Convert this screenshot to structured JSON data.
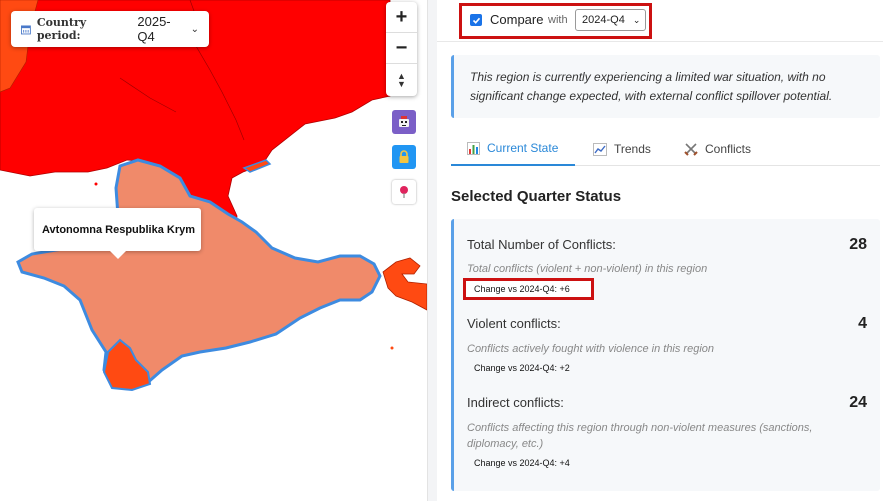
{
  "map": {
    "period_label": "Country period:",
    "period_value": "2025-Q4",
    "zoom_in": "+",
    "zoom_out": "−",
    "tooltip": "Avtonomna Respublika Krym"
  },
  "compare": {
    "label": "Compare",
    "checked": true,
    "with_label": "with",
    "value": "2024-Q4"
  },
  "callout_text": "This region is currently experiencing a limited war situation, with no significant change expected, with external conflict spillover potential.",
  "tabs": [
    {
      "label": "Current State",
      "icon": "bar-chart-icon",
      "active": true
    },
    {
      "label": "Trends",
      "icon": "line-chart-icon",
      "active": false
    },
    {
      "label": "Conflicts",
      "icon": "crossed-swords-icon",
      "active": false
    }
  ],
  "section_title": "Selected Quarter Status",
  "stats": [
    {
      "name": "Total Number of Conflicts:",
      "value": "28",
      "description": "Total conflicts (violent + non-violent) in this region",
      "change": "Change vs 2024-Q4: +6"
    },
    {
      "name": "Violent conflicts:",
      "value": "4",
      "description": "Conflicts actively fought with violence in this region",
      "change": "Change vs 2024-Q4: +2"
    },
    {
      "name": "Indirect conflicts:",
      "value": "24",
      "description": "Conflicts affecting this region through non-violent measures (sanctions, diplomacy, etc.)",
      "change": "Change vs 2024-Q4: +4"
    }
  ],
  "colors": {
    "accent": "#2a88d8",
    "highlight": "#cc1111",
    "map_red": "#ff0000",
    "map_salmon": "#f08a6a",
    "map_orange": "#ff4a12",
    "border_blue": "#3d8be0"
  }
}
